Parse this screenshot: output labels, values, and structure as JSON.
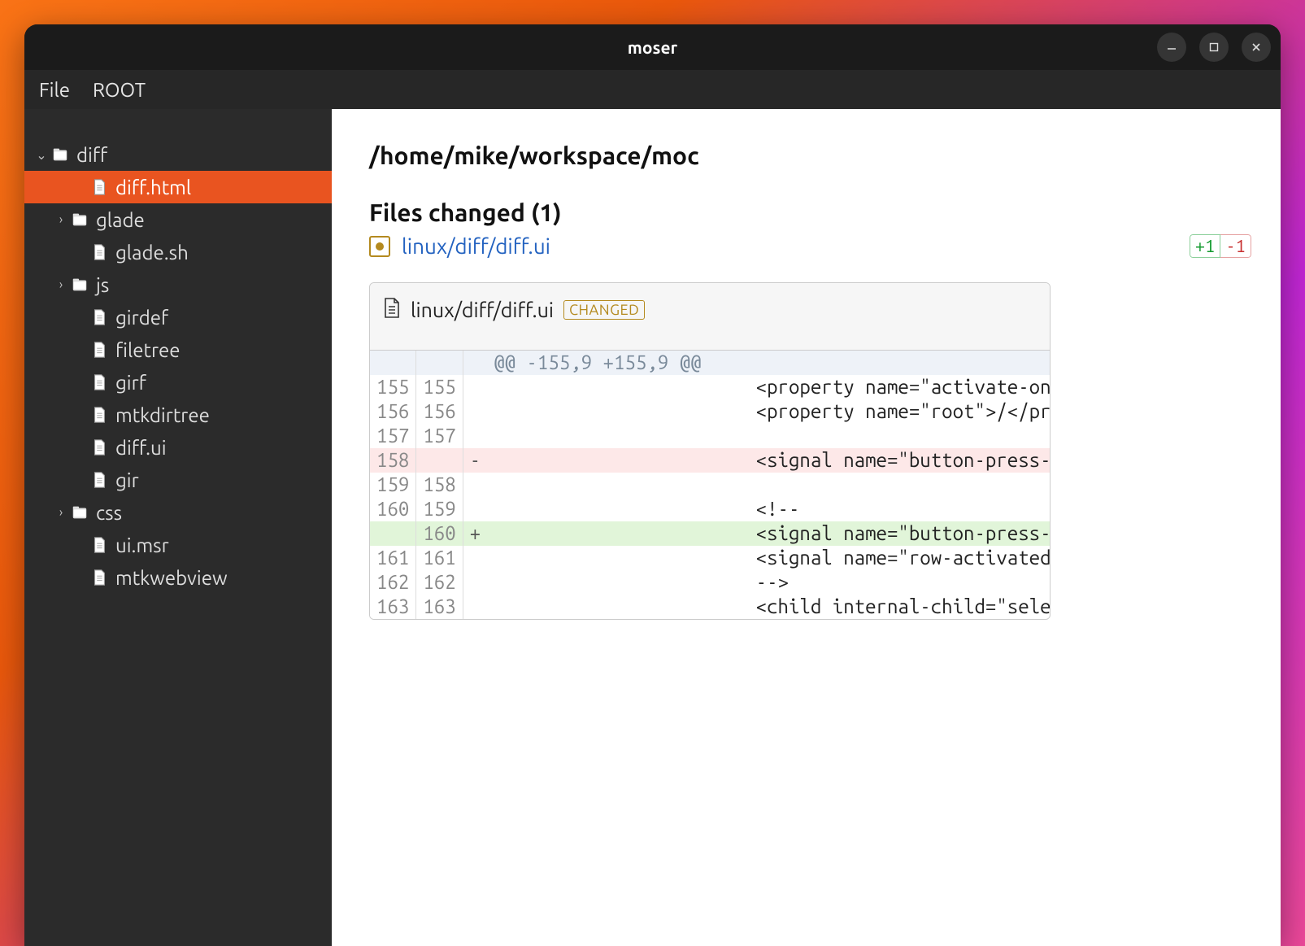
{
  "window": {
    "title": "moser"
  },
  "menu": {
    "file": "File",
    "root": "ROOT"
  },
  "tree": [
    {
      "type": "folder",
      "label": "diff",
      "depth": 0,
      "expand": "down",
      "selected": false
    },
    {
      "type": "file",
      "label": "diff.html",
      "depth": 1,
      "expand": "",
      "selected": true
    },
    {
      "type": "folder",
      "label": "glade",
      "depth": 1,
      "expand": "right",
      "selected": false
    },
    {
      "type": "file",
      "label": "glade.sh",
      "depth": 1,
      "expand": "",
      "selected": false
    },
    {
      "type": "folder",
      "label": "js",
      "depth": 1,
      "expand": "right",
      "selected": false
    },
    {
      "type": "file",
      "label": "girdef",
      "depth": 1,
      "expand": "",
      "selected": false
    },
    {
      "type": "file",
      "label": "filetree",
      "depth": 1,
      "expand": "",
      "selected": false
    },
    {
      "type": "file",
      "label": "girf",
      "depth": 1,
      "expand": "",
      "selected": false
    },
    {
      "type": "file",
      "label": "mtkdirtree",
      "depth": 1,
      "expand": "",
      "selected": false
    },
    {
      "type": "file",
      "label": "diff.ui",
      "depth": 1,
      "expand": "",
      "selected": false
    },
    {
      "type": "file",
      "label": "gir",
      "depth": 1,
      "expand": "",
      "selected": false
    },
    {
      "type": "folder",
      "label": "css",
      "depth": 1,
      "expand": "right",
      "selected": false
    },
    {
      "type": "file",
      "label": "ui.msr",
      "depth": 1,
      "expand": "",
      "selected": false
    },
    {
      "type": "file",
      "label": "mtkwebview",
      "depth": 1,
      "expand": "",
      "selected": false
    }
  ],
  "content": {
    "path": "/home/mike/workspace/moc",
    "files_changed_heading": "Files changed (1)",
    "file_link": "linux/diff/diff.ui",
    "plus": "+1",
    "minus": "-1",
    "diff_file": "linux/diff/diff.ui",
    "status": "CHANGED",
    "diff": [
      {
        "t": "hunk",
        "old": "",
        "new": "",
        "s": "",
        "c": "@@ -155,9 +155,9 @@"
      },
      {
        "t": "ctx",
        "old": "155",
        "new": "155",
        "s": "",
        "c": "                        <property name=\"activate-on-"
      },
      {
        "t": "ctx",
        "old": "156",
        "new": "156",
        "s": "",
        "c": "                        <property name=\"root\">/</pro"
      },
      {
        "t": "ctx",
        "old": "157",
        "new": "157",
        "s": "",
        "c": ""
      },
      {
        "t": "del",
        "old": "158",
        "new": "",
        "s": "-",
        "c": "                        <signal name=\"button-press-e"
      },
      {
        "t": "ctx",
        "old": "159",
        "new": "158",
        "s": "",
        "c": ""
      },
      {
        "t": "ctx",
        "old": "160",
        "new": "159",
        "s": "",
        "c": "                        <!--"
      },
      {
        "t": "add",
        "old": "",
        "new": "160",
        "s": "+",
        "c": "                        <signal name=\"button-press-e"
      },
      {
        "t": "ctx",
        "old": "161",
        "new": "161",
        "s": "",
        "c": "                        <signal name=\"row-activated\""
      },
      {
        "t": "ctx",
        "old": "162",
        "new": "162",
        "s": "",
        "c": "                        -->"
      },
      {
        "t": "ctx",
        "old": "163",
        "new": "163",
        "s": "",
        "c": "                        <child internal-child=\"selec"
      }
    ]
  }
}
